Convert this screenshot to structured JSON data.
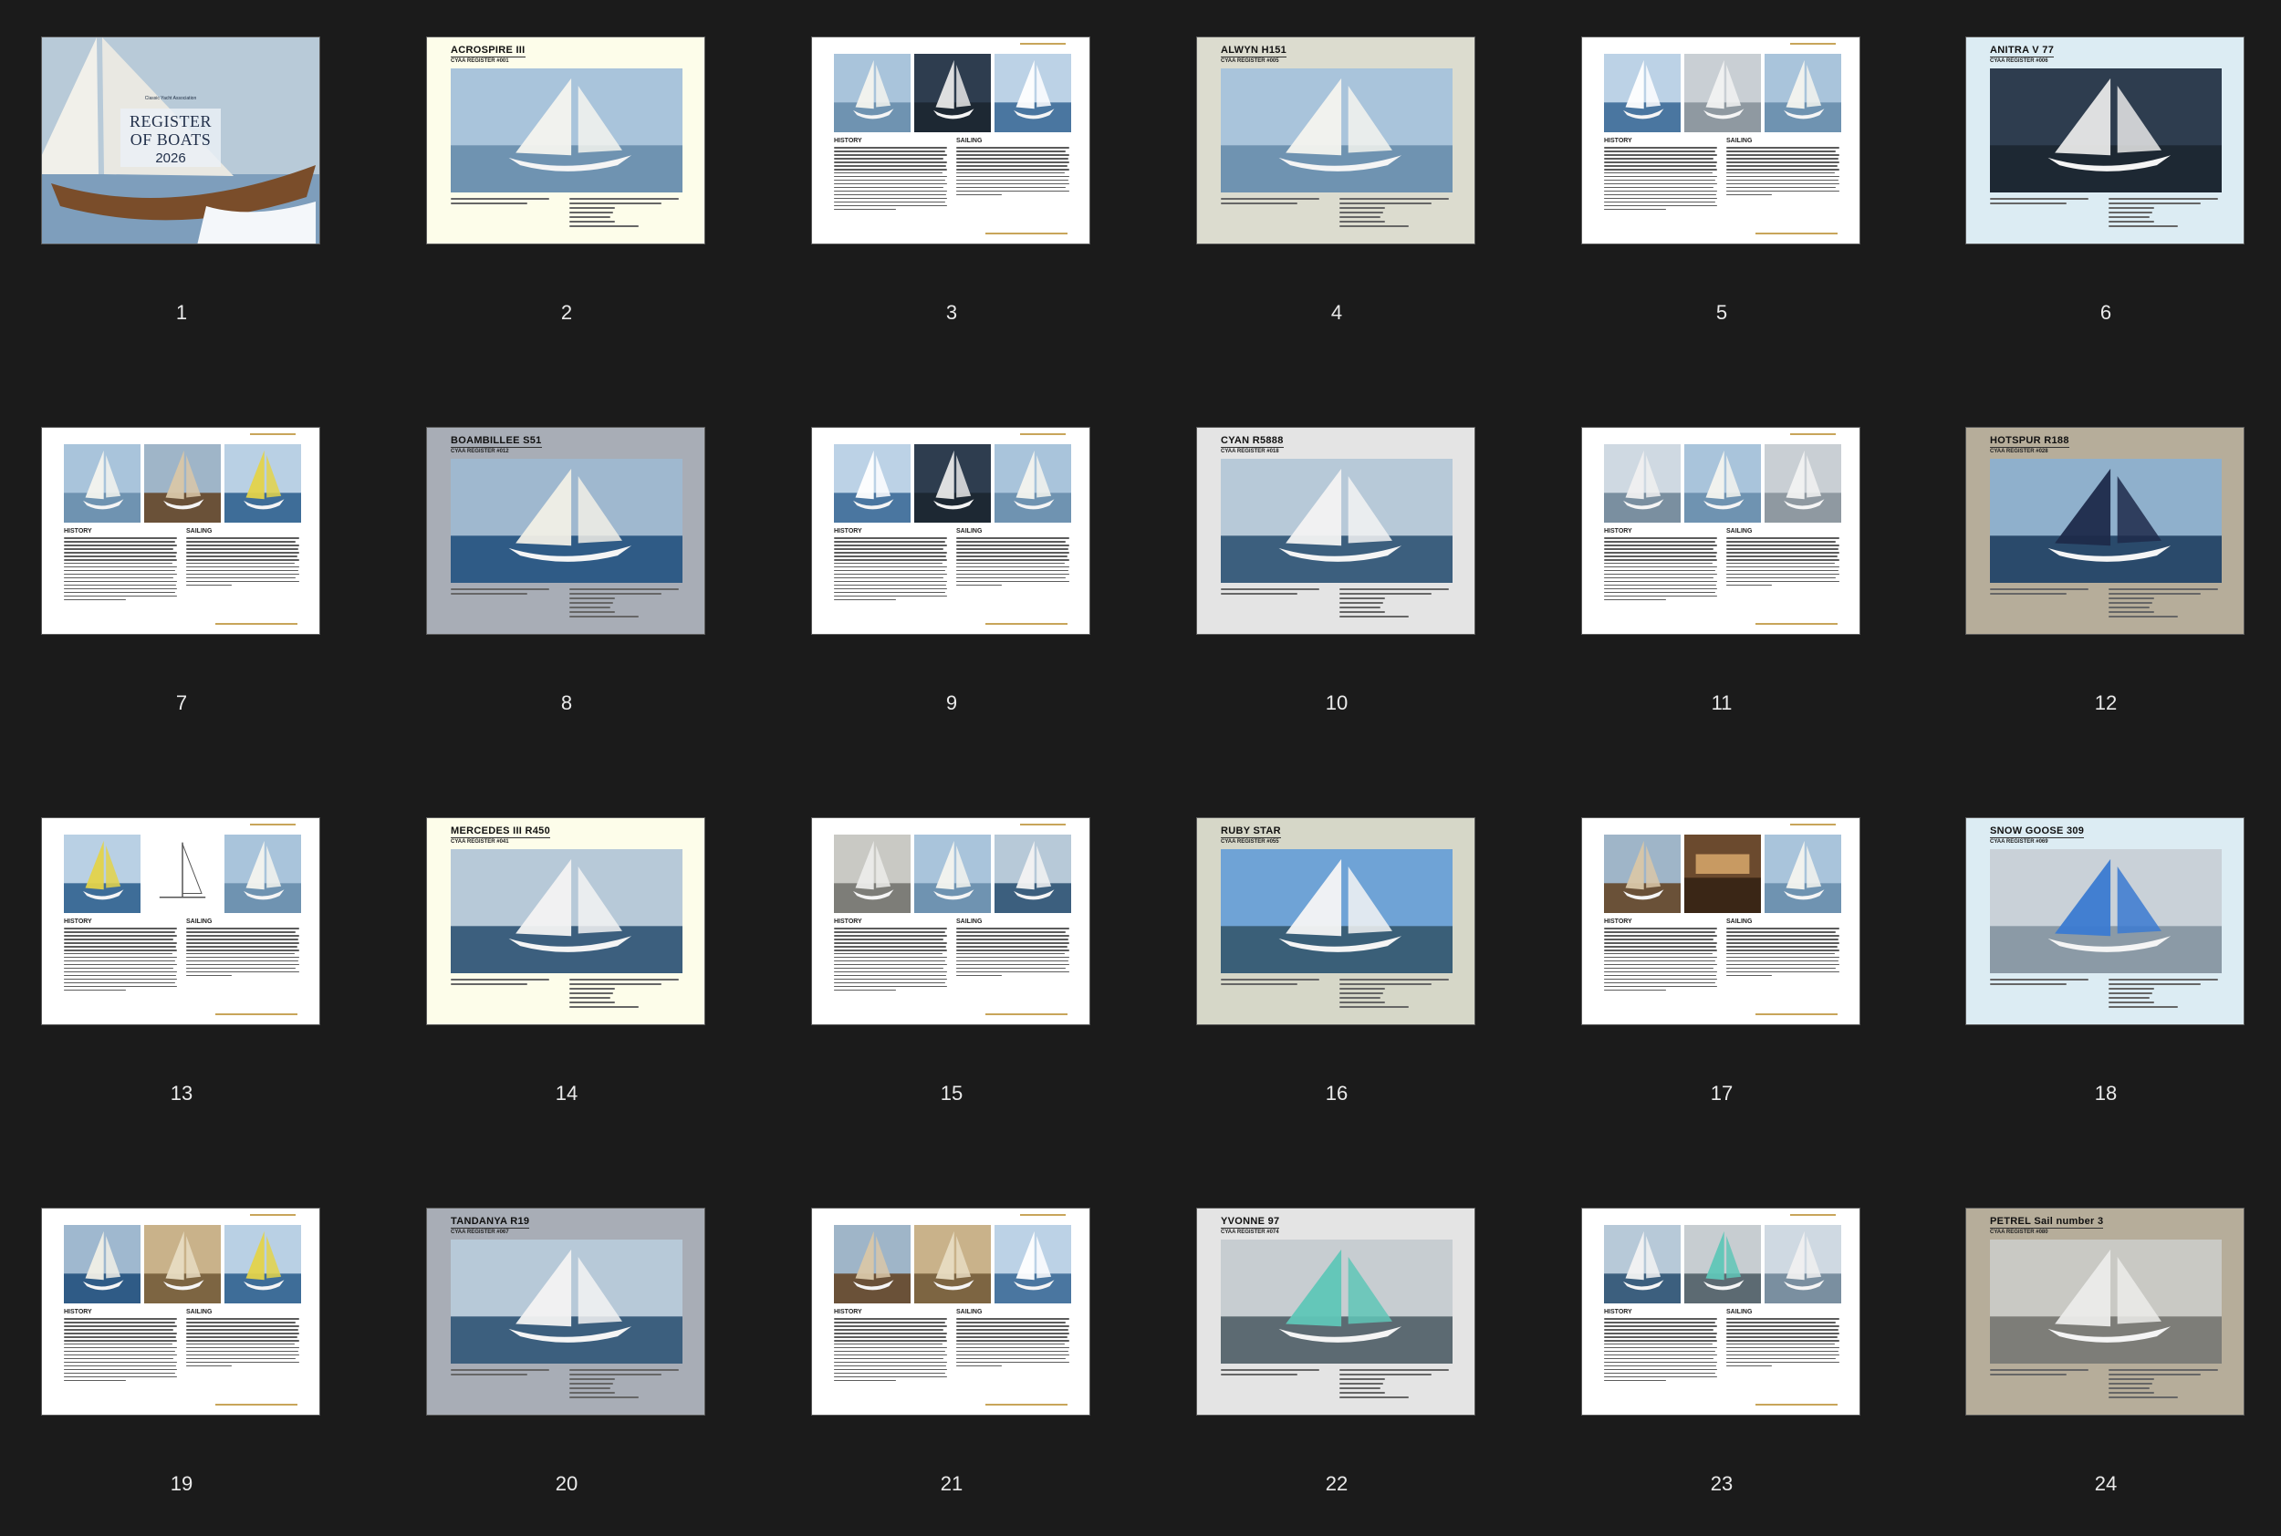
{
  "cover": {
    "small_text": "Classic Yacht Association",
    "title_line1": "REGISTER",
    "title_line2": "OF BOATS",
    "year": "2026"
  },
  "pages": [
    {
      "number": "1",
      "kind": "cover",
      "bg": "#cfd8e2"
    },
    {
      "number": "2",
      "kind": "boat",
      "bg": "#fdfdea",
      "title": "ACROSPIRE III",
      "sub": "CYAA REGISTER #001",
      "hero": "sail"
    },
    {
      "number": "3",
      "kind": "text",
      "bg": "#ffffff",
      "history": "HISTORY",
      "sailing": "SAILING",
      "p": [
        "sail",
        "dark",
        "sea"
      ]
    },
    {
      "number": "4",
      "kind": "boat",
      "bg": "#dcdccf",
      "title": "ALWYN H151",
      "sub": "CYAA REGISTER #005",
      "hero": "sail"
    },
    {
      "number": "5",
      "kind": "text",
      "bg": "#ffffff",
      "history": "HISTORY",
      "sailing": "SAILING",
      "p": [
        "sea",
        "grey",
        "sail"
      ]
    },
    {
      "number": "6",
      "kind": "boat",
      "bg": "#dcecf3",
      "title": "ANITRA V  77",
      "sub": "CYAA REGISTER #006",
      "hero": "dark"
    },
    {
      "number": "7",
      "kind": "text",
      "bg": "#ffffff",
      "history": "HISTORY",
      "sailing": "SAILING",
      "p": [
        "sail",
        "wood",
        "spin"
      ]
    },
    {
      "number": "8",
      "kind": "boat",
      "bg": "#a8adb6",
      "title": "BOAMBILLEE S51",
      "sub": "CYAA REGISTER #012",
      "hero": "race"
    },
    {
      "number": "9",
      "kind": "text",
      "bg": "#ffffff",
      "history": "HISTORY",
      "sailing": "SAILING",
      "p": [
        "sea",
        "dark",
        "sail"
      ]
    },
    {
      "number": "10",
      "kind": "boat",
      "bg": "#e4e4e4",
      "title": "CYAN R5888",
      "sub": "CYAA REGISTER #018",
      "hero": "crew"
    },
    {
      "number": "11",
      "kind": "text",
      "bg": "#ffffff",
      "history": "HISTORY",
      "sailing": "SAILING",
      "p": [
        "harbour",
        "sail",
        "grey"
      ]
    },
    {
      "number": "12",
      "kind": "boat",
      "bg": "#b6ad9a",
      "title": "HOTSPUR R188",
      "sub": "CYAA REGISTER #028",
      "hero": "marina"
    },
    {
      "number": "13",
      "kind": "text",
      "bg": "#ffffff",
      "history": "HISTORY",
      "sailing": "SAILING",
      "p": [
        "spin",
        "plan",
        "sail"
      ]
    },
    {
      "number": "14",
      "kind": "boat",
      "bg": "#fdfdea",
      "title": "MERCEDES III R450",
      "sub": "CYAA REGISTER #041",
      "hero": "crew"
    },
    {
      "number": "15",
      "kind": "text",
      "bg": "#ffffff",
      "history": "HISTORY",
      "sailing": "SAILING",
      "p": [
        "bw",
        "sail",
        "crew"
      ]
    },
    {
      "number": "16",
      "kind": "boat",
      "bg": "#d6d7c8",
      "title": "RUBY STAR",
      "sub": "CYAA REGISTER #055",
      "hero": "marina2"
    },
    {
      "number": "17",
      "kind": "text",
      "bg": "#ffffff",
      "history": "HISTORY",
      "sailing": "SAILING",
      "p": [
        "wood",
        "interior",
        "sail"
      ]
    },
    {
      "number": "18",
      "kind": "boat",
      "bg": "#dcecf3",
      "title": "SNOW GOOSE 309",
      "sub": "CYAA REGISTER #069",
      "hero": "bluesail"
    },
    {
      "number": "19",
      "kind": "text",
      "bg": "#ffffff",
      "history": "HISTORY",
      "sailing": "SAILING",
      "p": [
        "race",
        "sepia",
        "spin"
      ]
    },
    {
      "number": "20",
      "kind": "boat",
      "bg": "#a8adb6",
      "title": "TANDANYA R19",
      "sub": "CYAA REGISTER #067",
      "hero": "crew"
    },
    {
      "number": "21",
      "kind": "text",
      "bg": "#ffffff",
      "history": "HISTORY",
      "sailing": "SAILING",
      "p": [
        "wood",
        "sepia",
        "sea"
      ]
    },
    {
      "number": "22",
      "kind": "boat",
      "bg": "#e4e4e4",
      "title": "YVONNE  97",
      "sub": "CYAA REGISTER #074",
      "hero": "teal"
    },
    {
      "number": "23",
      "kind": "text",
      "bg": "#ffffff",
      "history": "HISTORY",
      "sailing": "SAILING",
      "p": [
        "crew",
        "teal",
        "harbour"
      ]
    },
    {
      "number": "24",
      "kind": "boat",
      "bg": "#b6ad9a",
      "title": "PETREL  Sail number 3",
      "sub": "CYAA REGISTER #080",
      "hero": "bw"
    }
  ]
}
